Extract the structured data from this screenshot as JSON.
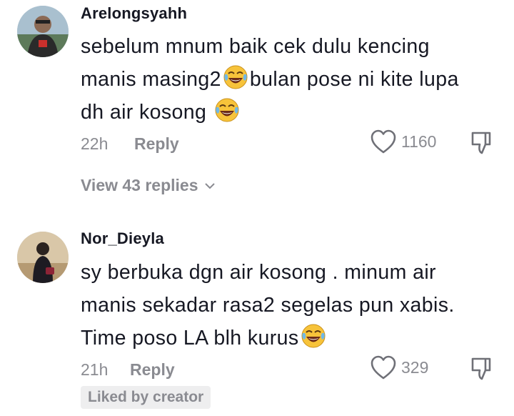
{
  "comments": [
    {
      "username": "Arelongsyahh",
      "line1": "sebelum mnum baik cek dulu kencing",
      "line2a": "manis masing2",
      "line2b": "bulan pose ni kite lupa",
      "line3": "dh air kosong",
      "time": "22h",
      "reply_label": "Reply",
      "likes": "1160",
      "view_replies": "View 43 replies"
    },
    {
      "username": "Nor_Dieyla",
      "line1": "sy berbuka dgn air kosong . minum air",
      "line2": "manis sekadar rasa2 segelas pun xabis.",
      "line3": "Time poso LA blh kurus",
      "time": "21h",
      "reply_label": "Reply",
      "likes": "329",
      "badge": "Liked by creator"
    }
  ],
  "colors": {
    "text": "#161823",
    "muted": "#8a8b91",
    "badge_bg": "#eeeeef"
  },
  "icons": [
    "heart-outline-icon",
    "thumbs-down-icon",
    "chevron-down-icon",
    "laughing-tears-emoji"
  ]
}
